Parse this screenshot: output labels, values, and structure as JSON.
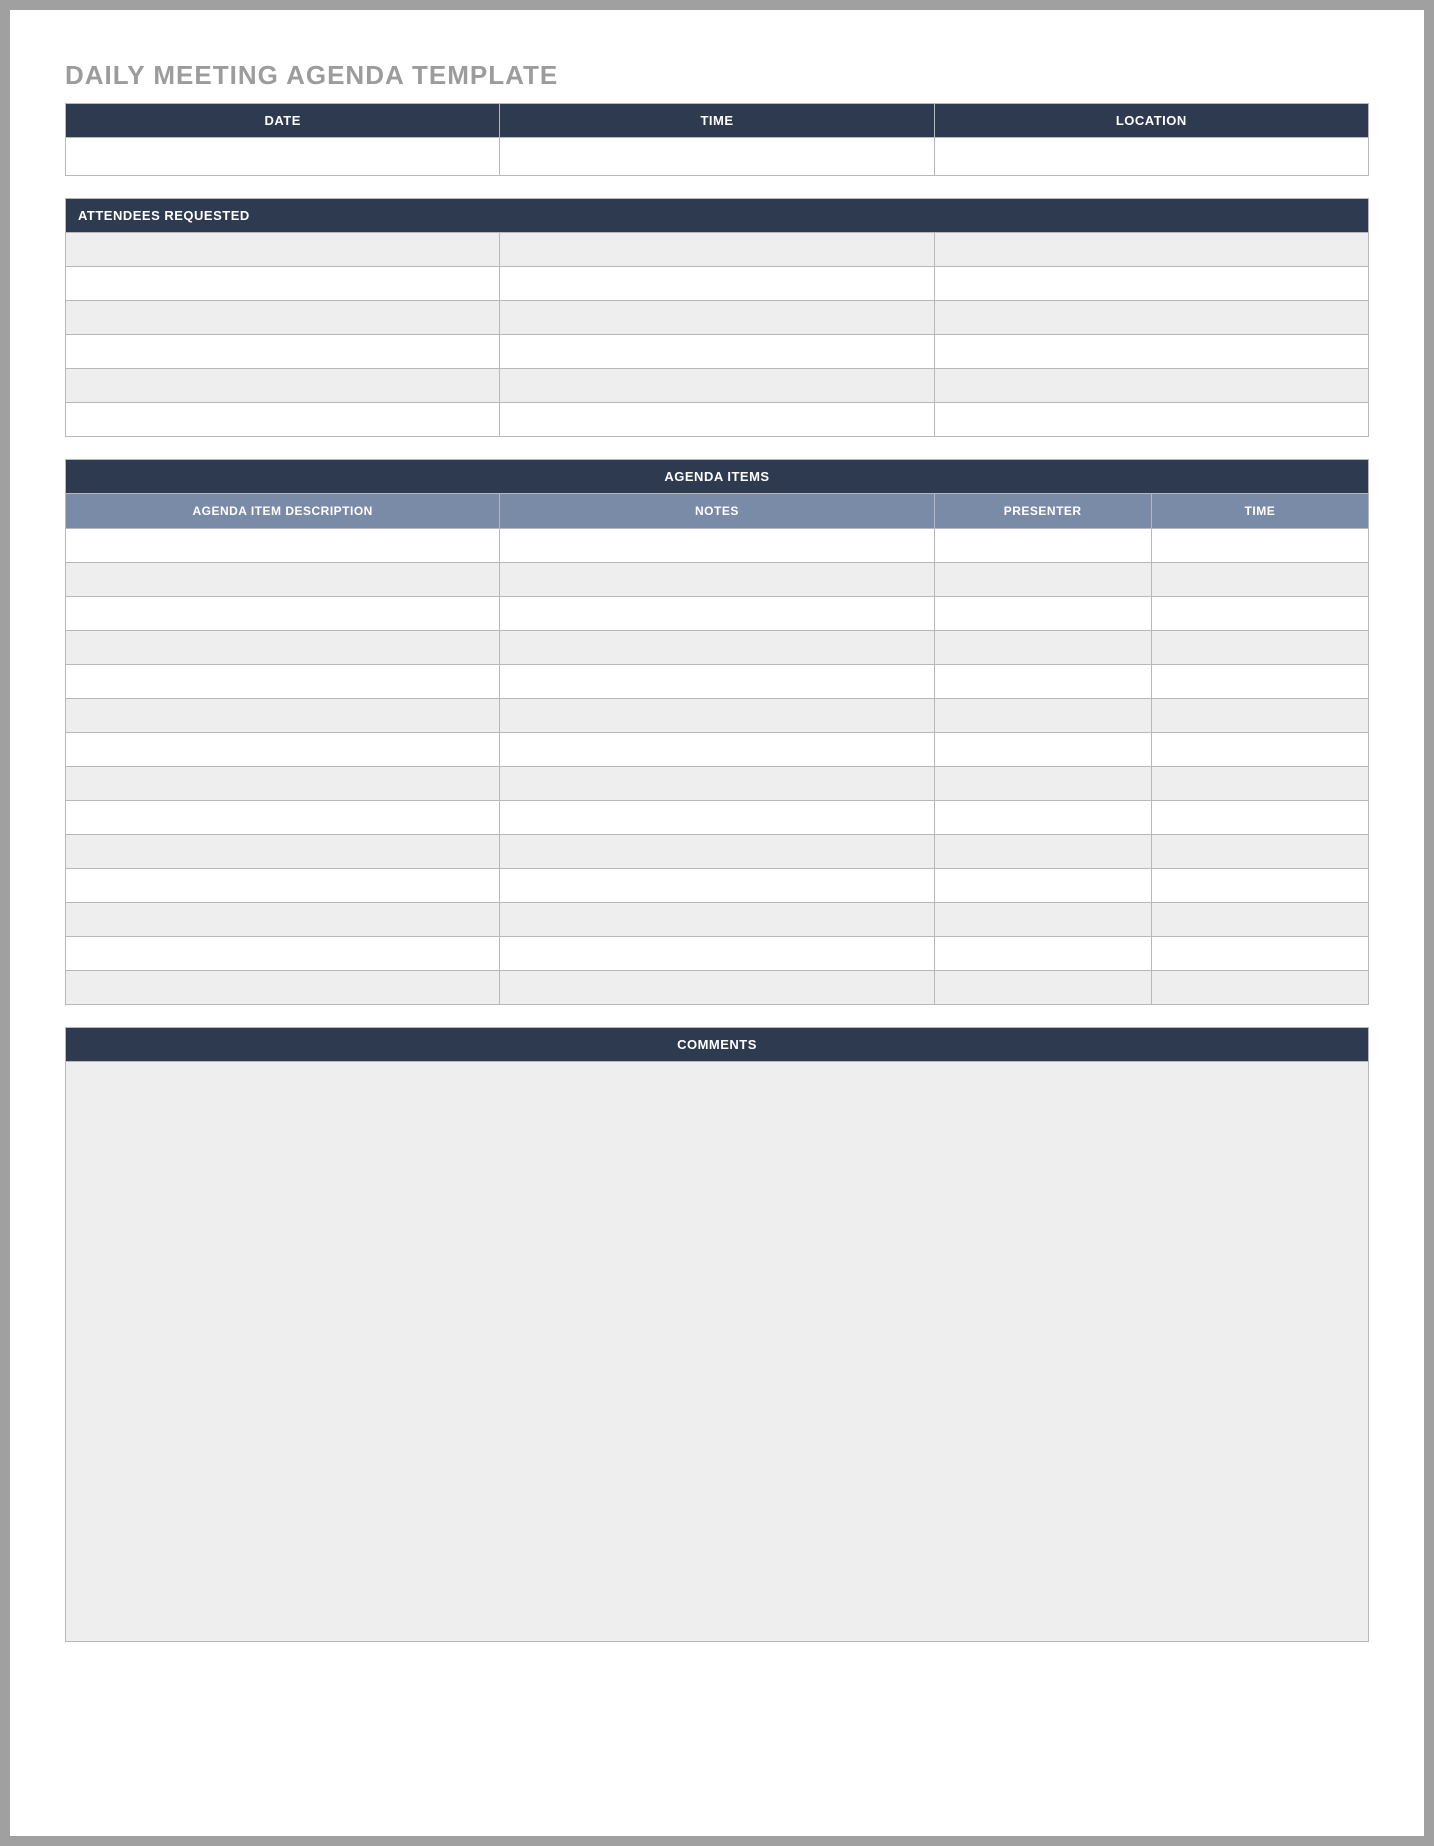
{
  "title": "DAILY MEETING AGENDA TEMPLATE",
  "meta": {
    "date_label": "DATE",
    "time_label": "TIME",
    "location_label": "LOCATION",
    "date_value": "",
    "time_value": "",
    "location_value": ""
  },
  "attendees": {
    "header": "ATTENDEES REQUESTED",
    "rows": [
      [
        "",
        "",
        ""
      ],
      [
        "",
        "",
        ""
      ],
      [
        "",
        "",
        ""
      ],
      [
        "",
        "",
        ""
      ],
      [
        "",
        "",
        ""
      ],
      [
        "",
        "",
        ""
      ]
    ]
  },
  "agenda": {
    "header": "AGENDA ITEMS",
    "columns": {
      "description": "AGENDA ITEM DESCRIPTION",
      "notes": "NOTES",
      "presenter": "PRESENTER",
      "time": "TIME"
    },
    "rows": [
      {
        "description": "",
        "notes": "",
        "presenter": "",
        "time": ""
      },
      {
        "description": "",
        "notes": "",
        "presenter": "",
        "time": ""
      },
      {
        "description": "",
        "notes": "",
        "presenter": "",
        "time": ""
      },
      {
        "description": "",
        "notes": "",
        "presenter": "",
        "time": ""
      },
      {
        "description": "",
        "notes": "",
        "presenter": "",
        "time": ""
      },
      {
        "description": "",
        "notes": "",
        "presenter": "",
        "time": ""
      },
      {
        "description": "",
        "notes": "",
        "presenter": "",
        "time": ""
      },
      {
        "description": "",
        "notes": "",
        "presenter": "",
        "time": ""
      },
      {
        "description": "",
        "notes": "",
        "presenter": "",
        "time": ""
      },
      {
        "description": "",
        "notes": "",
        "presenter": "",
        "time": ""
      },
      {
        "description": "",
        "notes": "",
        "presenter": "",
        "time": ""
      },
      {
        "description": "",
        "notes": "",
        "presenter": "",
        "time": ""
      },
      {
        "description": "",
        "notes": "",
        "presenter": "",
        "time": ""
      },
      {
        "description": "",
        "notes": "",
        "presenter": "",
        "time": ""
      }
    ]
  },
  "comments": {
    "header": "COMMENTS",
    "value": ""
  }
}
